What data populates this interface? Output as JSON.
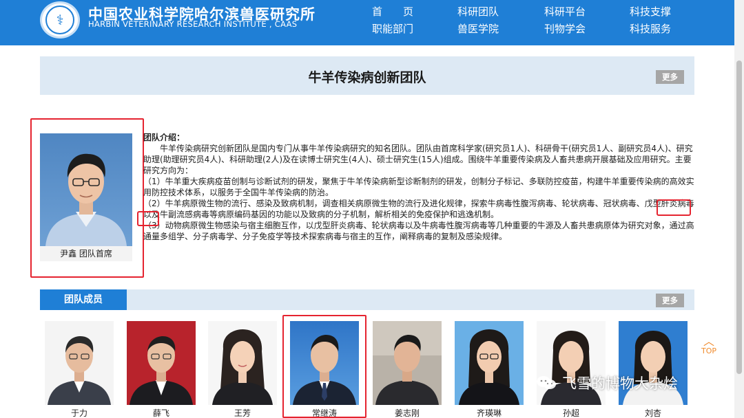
{
  "header": {
    "logo_cn": "中国农业科学院哈尔滨兽医研究所",
    "logo_en": "HARBIN VETERINARY RESEARCH INSTITUTE , CAAS",
    "nav": [
      {
        "label": "首　　页"
      },
      {
        "label": "科研团队"
      },
      {
        "label": "科研平台"
      },
      {
        "label": "科技支撑"
      },
      {
        "label": "职能部门"
      },
      {
        "label": "兽医学院"
      },
      {
        "label": "刊物学会"
      },
      {
        "label": "科技服务"
      }
    ],
    "background_color": "#1f7fd6"
  },
  "team": {
    "title": "牛羊传染病创新团队",
    "more_label": "更多"
  },
  "leader": {
    "caption": "尹鑫 团队首席"
  },
  "intro": {
    "heading": "团队介绍：",
    "paragraph": "牛羊传染病研究创新团队是国内专门从事牛羊传染病研究的知名团队。团队由首席科学家(研究员1人)、科研骨干(研究员1人、副研究员4人)、研究助理(助理研究员4人)、科研助理(2人)及在读博士研究生(4人)、硕士研究生(15人)组成。围绕牛羊重要传染病及人畜共患病开展基础及应用研究。主要研究方向为：",
    "items": [
      "（1）牛羊重大疾病疫苗创制与诊断试剂的研发，聚焦于牛羊传染病新型诊断制剂的研发，创制分子标记、多联防控疫苗，构建牛羊重要传染病的高效实用防控技术体系，以服务于全国牛羊传染病的防治。",
      "（2）牛羊病原微生物的流行、感染及致病机制，调查相关病原微生物的流行及进化规律，探索牛病毒性腹泻病毒、轮状病毒、冠状病毒、戊型肝炎病毒以及牛副流感病毒等病原编码基因的功能以及致病的分子机制，解析相关的免疫保护和逃逸机制。",
      "（3）动物病原微生物感染与宿主细胞互作，以戊型肝炎病毒、轮状病毒以及牛病毒性腹泻病毒等几种重要的牛源及人畜共患病原体为研究对象，通过高通量多组学、分子病毒学、分子免疫学等技术探索病毒与宿主的互作，阐释病毒的复制及感染规律。"
    ]
  },
  "members_section": {
    "title": "团队成员",
    "more_label": "更多",
    "members": [
      {
        "name": "于力"
      },
      {
        "name": "薛飞"
      },
      {
        "name": "王芳"
      },
      {
        "name": "常继涛"
      },
      {
        "name": "姜志刚"
      },
      {
        "name": "齐瑛琳"
      },
      {
        "name": "孙超"
      },
      {
        "name": "刘杏"
      }
    ]
  },
  "top_button": {
    "label": "TOP"
  },
  "watermark": {
    "text": "飞雪的博物大杂烩"
  },
  "colors": {
    "accent_blue": "#1f7fd6",
    "banner_bg": "#dde9f4",
    "highlight_red": "#e5232f",
    "more_grey": "#a6a6a6",
    "top_orange": "#f08a2b"
  }
}
